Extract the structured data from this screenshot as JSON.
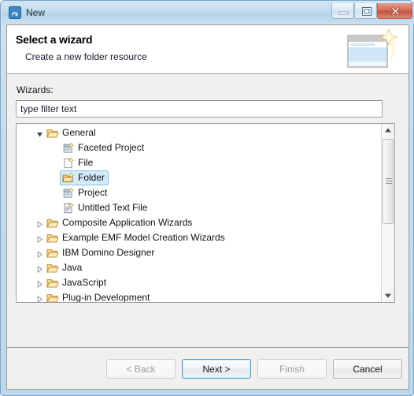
{
  "window": {
    "title": "New",
    "icon": "eclipse-new-wizard-icon",
    "controls": {
      "minimize": "minimize-icon",
      "maximize": "maximize-icon",
      "close": "close-icon"
    }
  },
  "banner": {
    "title": "Select a wizard",
    "description": "Create a new folder resource",
    "icon": "wizard-banner-icon"
  },
  "content": {
    "wizards_label": "Wizards:",
    "filter": {
      "value": "",
      "placeholder": "type filter text"
    }
  },
  "tree": {
    "nodes": [
      {
        "label": "General",
        "depth": 0,
        "expanded": true,
        "icon": "open-folder-icon",
        "selected": false
      },
      {
        "label": "Faceted Project",
        "depth": 1,
        "icon": "project-wizard-icon",
        "selected": false
      },
      {
        "label": "File",
        "depth": 1,
        "icon": "file-wizard-icon",
        "selected": false
      },
      {
        "label": "Folder",
        "depth": 1,
        "icon": "folder-wizard-icon",
        "selected": true
      },
      {
        "label": "Project",
        "depth": 1,
        "icon": "project-wizard-icon",
        "selected": false
      },
      {
        "label": "Untitled Text File",
        "depth": 1,
        "icon": "text-file-wizard-icon",
        "selected": false
      },
      {
        "label": "Composite Application Wizards",
        "depth": 0,
        "expanded": false,
        "icon": "closed-folder-icon",
        "selected": false
      },
      {
        "label": "Example EMF Model Creation Wizards",
        "depth": 0,
        "expanded": false,
        "icon": "closed-folder-icon",
        "selected": false
      },
      {
        "label": "IBM Domino Designer",
        "depth": 0,
        "expanded": false,
        "icon": "closed-folder-icon",
        "selected": false
      },
      {
        "label": "Java",
        "depth": 0,
        "expanded": false,
        "icon": "closed-folder-icon",
        "selected": false
      },
      {
        "label": "JavaScript",
        "depth": 0,
        "expanded": false,
        "icon": "closed-folder-icon",
        "selected": false
      },
      {
        "label": "Plug-in Development",
        "depth": 0,
        "expanded": false,
        "icon": "closed-folder-icon",
        "selected": false
      }
    ]
  },
  "buttons": {
    "back": {
      "label": "< Back",
      "enabled": false,
      "default": false
    },
    "next": {
      "label": "Next >",
      "enabled": true,
      "default": true
    },
    "finish": {
      "label": "Finish",
      "enabled": false,
      "default": false
    },
    "cancel": {
      "label": "Cancel",
      "enabled": true,
      "default": false
    }
  },
  "colors": {
    "titlebar": "#c2dcee",
    "dialog_bg": "#f1f0ee",
    "selection_fill": "#d4ebf9",
    "selection_border": "#86c3e6",
    "default_button_border": "#3c9fd4",
    "close_button": "#c2543f",
    "folder_icon": "#e8b760",
    "disabled_text": "#9d9d9d"
  }
}
